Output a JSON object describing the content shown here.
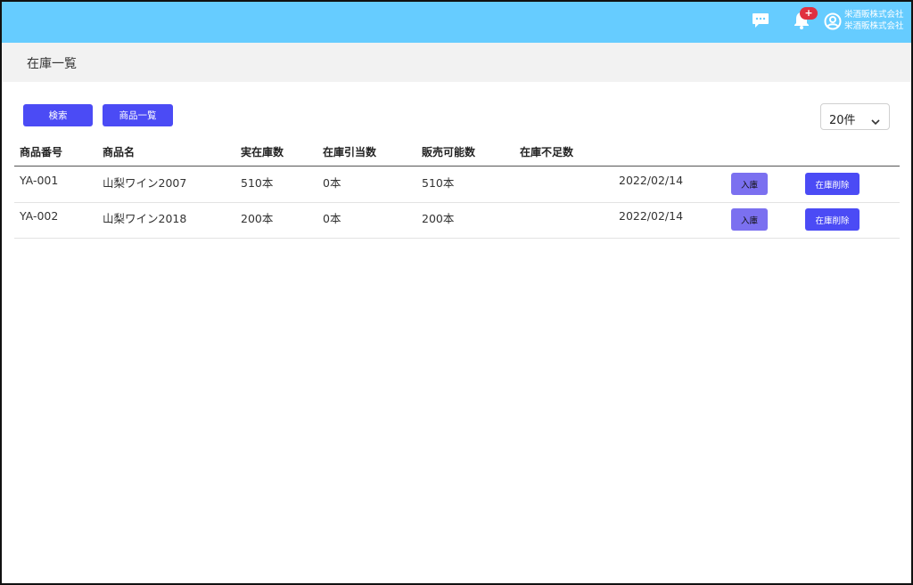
{
  "header": {
    "badge": "+",
    "user_line1": "栄酒販株式会社",
    "user_line2": "栄酒販株式会社",
    "icons": {
      "chat": "chat-icon",
      "bell": "bell-icon",
      "user": "account-circle-icon"
    },
    "bar_color": "#66ccff"
  },
  "page": {
    "title": "在庫一覧"
  },
  "toolbar": {
    "search_label": "検索",
    "list_label": "商品一覧",
    "page_size": "20件"
  },
  "table": {
    "columns": [
      "商品番号",
      "商品名",
      "実在庫数",
      "在庫引当数",
      "販売可能数",
      "在庫不足数"
    ],
    "rows": [
      {
        "code": "YA-001",
        "name": "山梨ワイン2007",
        "actual": "510本",
        "allocated": "0本",
        "available": "510本",
        "shortage": "",
        "date": "2022/02/14",
        "in_label": "入庫",
        "delete_label": "在庫削除"
      },
      {
        "code": "YA-002",
        "name": "山梨ワイン2018",
        "actual": "200本",
        "allocated": "0本",
        "available": "200本",
        "shortage": "",
        "date": "2022/02/14",
        "in_label": "入庫",
        "delete_label": "在庫削除"
      }
    ]
  },
  "colors": {
    "primary": "#4b4bf5",
    "secondary": "#7b70f0",
    "badge": "#e03040"
  }
}
